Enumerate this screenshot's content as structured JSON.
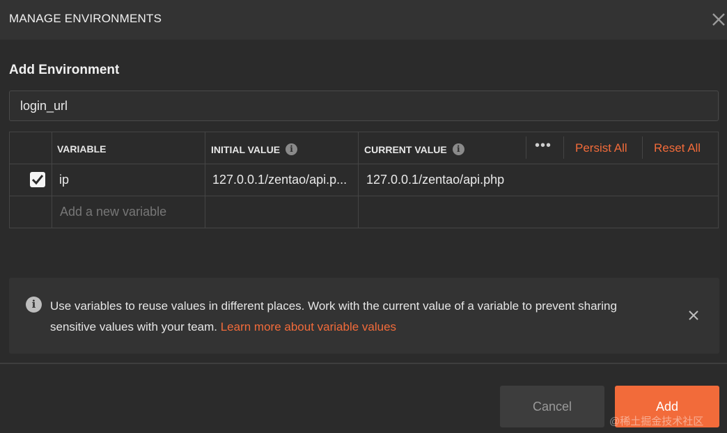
{
  "dialog": {
    "title": "MANAGE ENVIRONMENTS",
    "close_icon": "close-icon"
  },
  "section": {
    "title": "Add Environment",
    "env_name_value": "login_url"
  },
  "table": {
    "headers": {
      "variable": "VARIABLE",
      "initial_value": "INITIAL VALUE",
      "current_value": "CURRENT VALUE"
    },
    "more_label": "•••",
    "persist_all_label": "Persist All",
    "reset_all_label": "Reset All",
    "rows": [
      {
        "checked": true,
        "variable": "ip",
        "initial_value": "127.0.0.1/zentao/api.p...",
        "current_value": "127.0.0.1/zentao/api.php"
      }
    ],
    "new_variable_placeholder": "Add a new variable"
  },
  "banner": {
    "text": "Use variables to reuse values in different places. Work with the current value of a variable to prevent sharing sensitive values with your team. ",
    "link_text": "Learn more about variable values"
  },
  "footer": {
    "cancel_label": "Cancel",
    "add_label": "Add"
  },
  "watermark": "@稀土掘金技术社区",
  "colors": {
    "accent": "#f26b3a",
    "background": "#2b2b2b",
    "header": "#333333",
    "border": "#454545"
  }
}
